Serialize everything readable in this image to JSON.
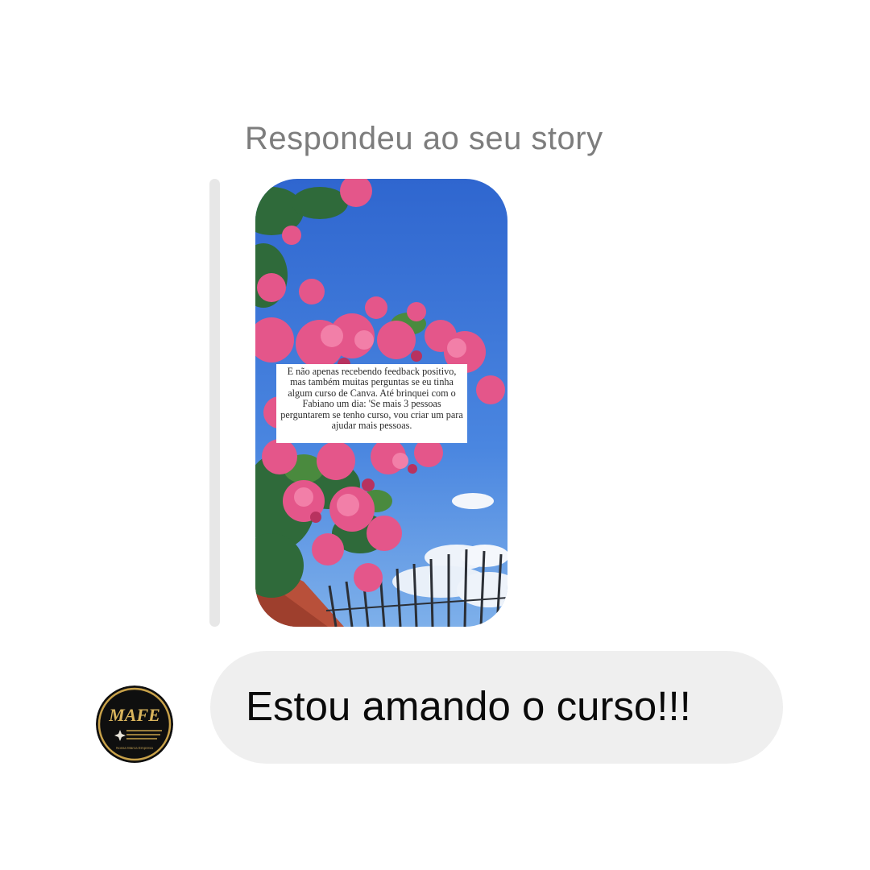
{
  "reply": {
    "header": "Respondeu ao seu story"
  },
  "story": {
    "caption": "E não apenas recebendo feedback positivo, mas também muitas perguntas se eu tinha algum curso de Canva. Até brinquei com o Fabiano um dia: 'Se mais 3 pessoas perguntarem se tenho curso, vou criar um para ajudar mais pessoas."
  },
  "message": {
    "text": "Estou amando o curso!!!"
  },
  "avatar": {
    "logo_text": "MAFE",
    "logo_subtext": "Nossa Marca Empresa"
  },
  "colors": {
    "bubble": "#efefef",
    "header_text": "#7d7d7d",
    "sky": "#3f7fdc",
    "blossom": "#e0507f",
    "avatar_gold": "#c9a24a"
  }
}
